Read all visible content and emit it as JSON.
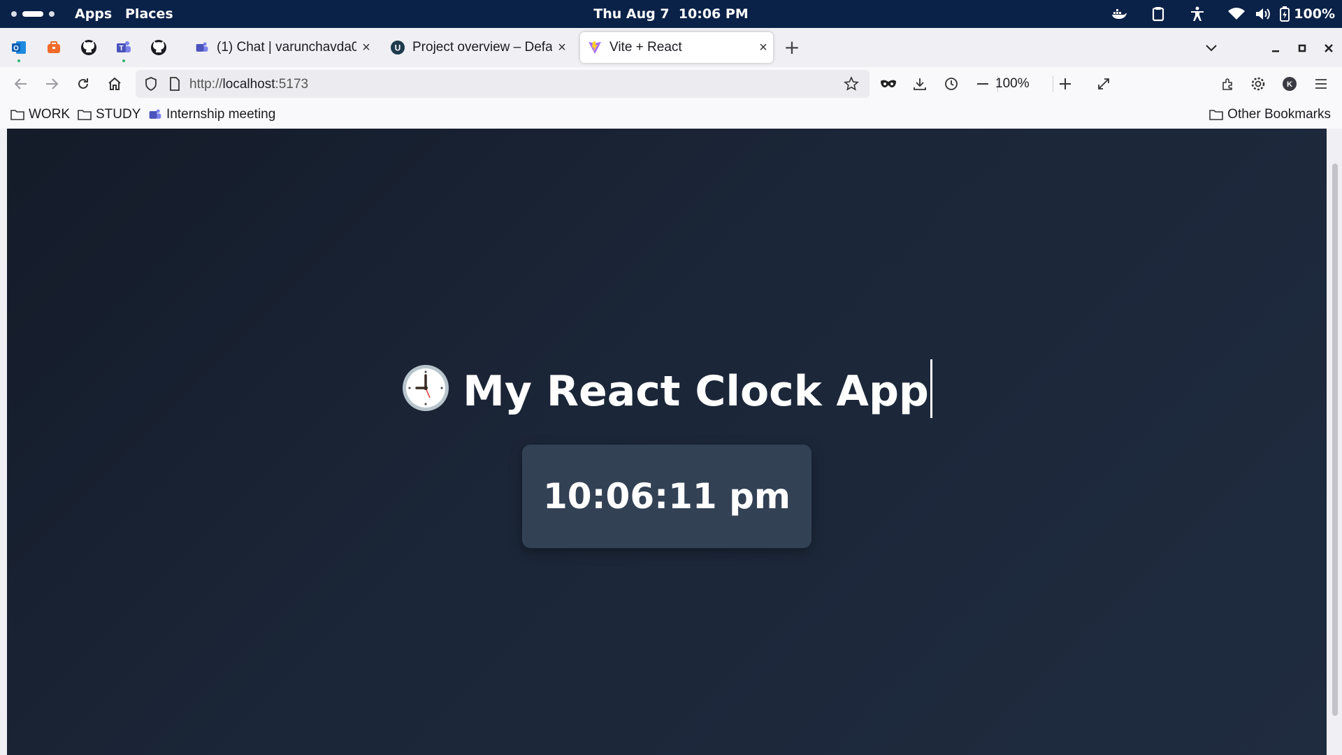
{
  "system_bar": {
    "apps_label": "Apps",
    "places_label": "Places",
    "date": "Thu Aug 7",
    "time": "10:06 PM",
    "battery": "100%"
  },
  "browser": {
    "tabs": [
      {
        "title": "(1) Chat | varunchavda0",
        "active": false
      },
      {
        "title": "Project overview – Defa",
        "active": false
      },
      {
        "title": "Vite + React",
        "active": true
      }
    ],
    "url_prefix": "http://",
    "url_host": "localhost",
    "url_suffix": ":5173",
    "zoom": "100%",
    "profile_initial": "K",
    "bookmarks": [
      "WORK",
      "STUDY",
      "Internship meeting"
    ],
    "other_bookmarks": "Other Bookmarks"
  },
  "page": {
    "heading": "My React Clock App",
    "clock_time": "10:06:11 pm"
  },
  "colors": {
    "system_bar": "#0a2148",
    "page_bg": "#1b2638",
    "clock_card": "#334155",
    "text": "#ffffff"
  }
}
